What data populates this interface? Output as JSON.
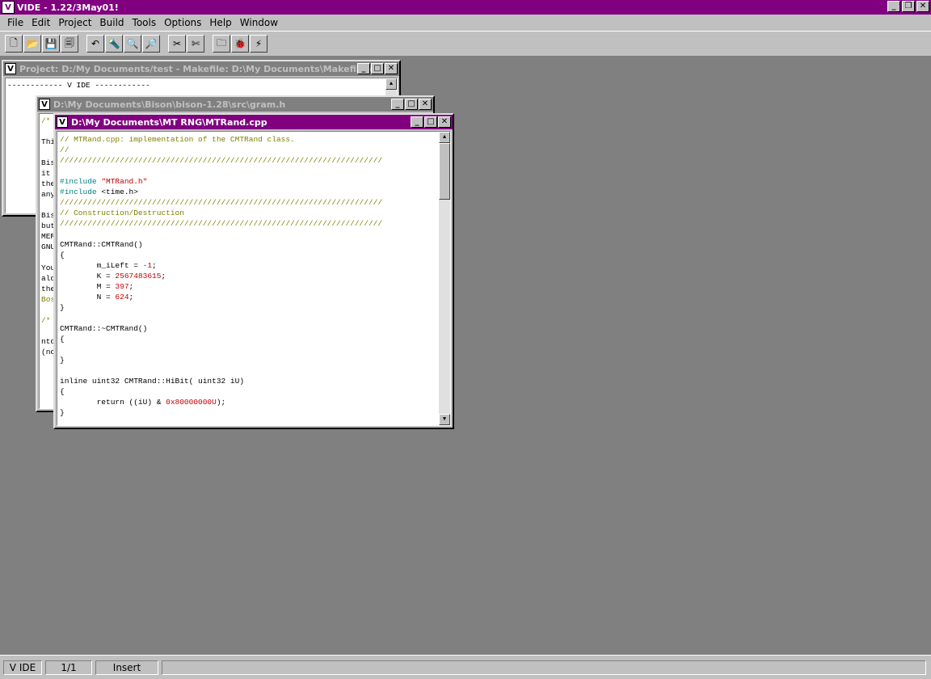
{
  "app": {
    "title": "VIDE - 1.22/3May01!",
    "icon_letter": "V"
  },
  "menu": [
    "File",
    "Edit",
    "Project",
    "Build",
    "Tools",
    "Options",
    "Help",
    "Window"
  ],
  "toolbar": [
    {
      "name": "new-file",
      "glyph": "🗋"
    },
    {
      "name": "open-file",
      "glyph": "📂"
    },
    {
      "name": "save-file",
      "glyph": "💾"
    },
    {
      "name": "save-all",
      "glyph": "🗐"
    },
    {
      "name": "undo",
      "glyph": "↶"
    },
    {
      "name": "find",
      "glyph": "🔦"
    },
    {
      "name": "find-next",
      "glyph": "🔍"
    },
    {
      "name": "replace",
      "glyph": "🔎"
    },
    {
      "name": "tool-a",
      "glyph": "✂"
    },
    {
      "name": "tool-b",
      "glyph": "✄"
    },
    {
      "name": "compile",
      "glyph": "🗀"
    },
    {
      "name": "debug",
      "glyph": "🐞"
    },
    {
      "name": "run",
      "glyph": "⚡"
    }
  ],
  "windows": {
    "project": {
      "title": "Project: D:/My Documents/test - Makefile: D:\\My Documents\\Makefile.v",
      "lines": [
        "------------ V IDE ------------"
      ]
    },
    "gram": {
      "title": "D:\\My Documents\\Bison\\bison-1.28\\src\\gram.h",
      "lines": [
        "/*",
        "",
        "Thi",
        "",
        "Bis",
        "it",
        "the",
        "any",
        "",
        "Bis",
        "but",
        "MER",
        "GNU",
        "",
        "You",
        "alc",
        "the",
        "Bos",
        "",
        "/*",
        "",
        "ntc",
        "(nc"
      ]
    },
    "mtrand": {
      "title": "D:\\My Documents\\MT RNG\\MTRand.cpp",
      "lines": [
        [
          {
            "t": "// MTRand.cpp: implementation of the CMTRand class.",
            "c": "c-comment"
          }
        ],
        [
          {
            "t": "//",
            "c": "c-comment"
          }
        ],
        [
          {
            "t": "//////////////////////////////////////////////////////////////////////",
            "c": "c-comment"
          }
        ],
        [
          {
            "t": ""
          }
        ],
        [
          {
            "t": "#include ",
            "c": "c-pre"
          },
          {
            "t": "\"MTRand.h\"",
            "c": "c-str"
          }
        ],
        [
          {
            "t": "#include ",
            "c": "c-pre"
          },
          {
            "t": "<time.h>"
          }
        ],
        [
          {
            "t": "//////////////////////////////////////////////////////////////////////",
            "c": "c-comment"
          }
        ],
        [
          {
            "t": "// Construction/Destruction",
            "c": "c-comment"
          }
        ],
        [
          {
            "t": "//////////////////////////////////////////////////////////////////////",
            "c": "c-comment"
          }
        ],
        [
          {
            "t": ""
          }
        ],
        [
          {
            "t": "CMTRand::CMTRand()"
          }
        ],
        [
          {
            "t": "{"
          }
        ],
        [
          {
            "t": "        m_iLeft = "
          },
          {
            "t": "-1",
            "c": "c-num"
          },
          {
            "t": ";"
          }
        ],
        [
          {
            "t": "        K = "
          },
          {
            "t": "2567483615",
            "c": "c-num"
          },
          {
            "t": ";"
          }
        ],
        [
          {
            "t": "        M = "
          },
          {
            "t": "397",
            "c": "c-num"
          },
          {
            "t": ";"
          }
        ],
        [
          {
            "t": "        N = "
          },
          {
            "t": "624",
            "c": "c-num"
          },
          {
            "t": ";"
          }
        ],
        [
          {
            "t": "}"
          }
        ],
        [
          {
            "t": ""
          }
        ],
        [
          {
            "t": "CMTRand::~CMTRand()"
          }
        ],
        [
          {
            "t": "{"
          }
        ],
        [
          {
            "t": ""
          }
        ],
        [
          {
            "t": "}"
          }
        ],
        [
          {
            "t": ""
          }
        ],
        [
          {
            "t": "inline uint32 CMTRand::HiBit( uint32 iU)"
          }
        ],
        [
          {
            "t": "{"
          }
        ],
        [
          {
            "t": "        return ((iU) & "
          },
          {
            "t": "0x80000000U",
            "c": "c-num"
          },
          {
            "t": ");"
          }
        ],
        [
          {
            "t": "}"
          }
        ]
      ]
    }
  },
  "status": {
    "app": "V IDE",
    "pos": "1/1",
    "mode": "Insert"
  }
}
